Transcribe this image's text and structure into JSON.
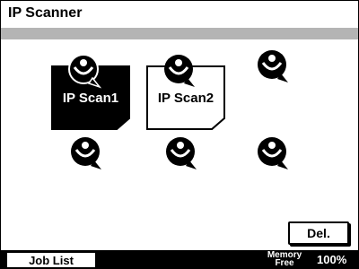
{
  "window": {
    "title": "IP Scanner"
  },
  "scanners": [
    {
      "label": "IP Scan1",
      "state": "selected"
    },
    {
      "label": "IP Scan2",
      "state": "normal"
    }
  ],
  "empty_slot_count": 4,
  "icon": "scanner-icon",
  "actions": {
    "delete_label": "Del."
  },
  "footer": {
    "job_list_label": "Job List",
    "memory_label": "Memory",
    "free_label": "Free",
    "memory_value": "100%"
  },
  "colors": {
    "selected_bg": "#000000",
    "band": "#b4b4b4"
  }
}
